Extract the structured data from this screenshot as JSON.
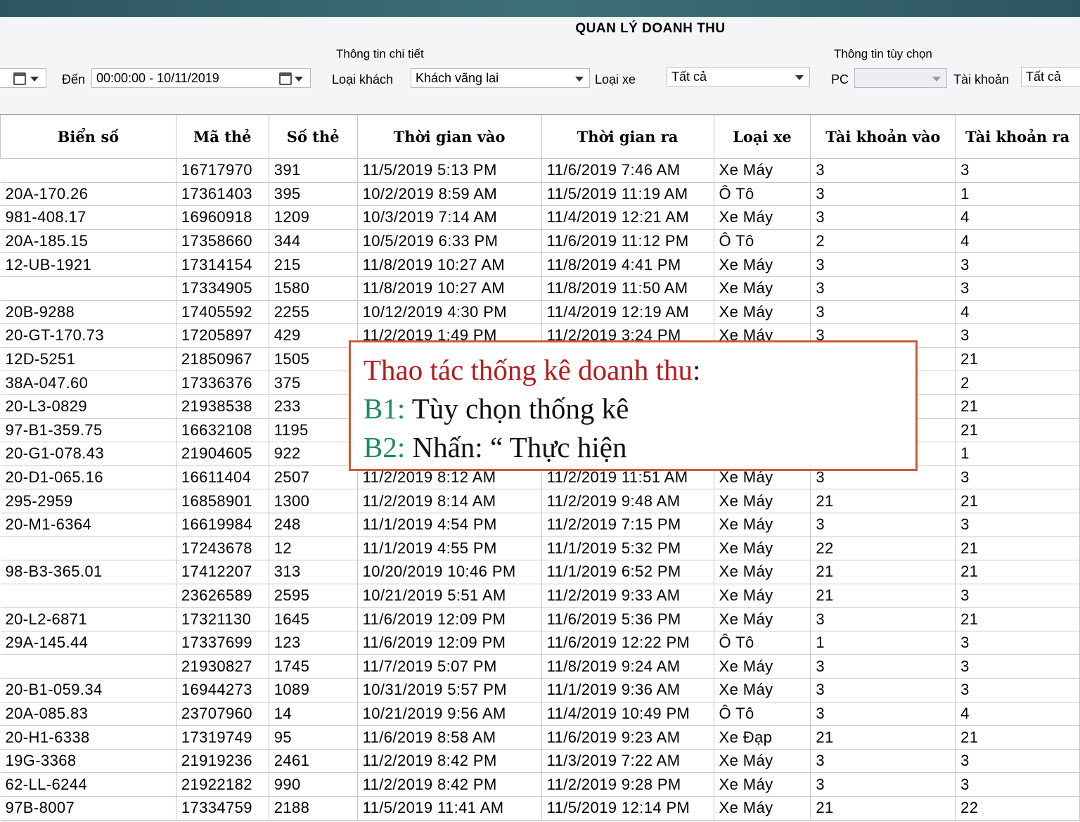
{
  "window": {
    "title": "QUAN LÝ DOANH THU"
  },
  "filters": {
    "to_label": "Đến",
    "to_value": "00:00:00 - 10/11/2019",
    "detail_group": "Thông tin chi tiết",
    "customer_type_label": "Loại khách",
    "customer_type_value": "Khách vãng lai",
    "vehicle_type_label": "Loại xe",
    "vehicle_type_value": "Tất cả",
    "option_group": "Thông tin tùy chọn",
    "pc_label": "PC",
    "pc_value": "",
    "account_label": "Tài khoản",
    "account_value": "Tất cả"
  },
  "table": {
    "columns": [
      "Biển số",
      "Mã thẻ",
      "Số thẻ",
      "Thời gian vào",
      "Thời gian ra",
      "Loại xe",
      "Tài khoản vào",
      "Tài khoản ra"
    ],
    "rows": [
      [
        "",
        "16717970",
        "391",
        "11/5/2019 5:13 PM",
        "11/6/2019 7:46 AM",
        "Xe Máy",
        "3",
        "3"
      ],
      [
        "20A-170.26",
        "17361403",
        "395",
        "10/2/2019 8:59 AM",
        "11/5/2019 11:19 AM",
        "Ô Tô",
        "3",
        "1"
      ],
      [
        "981-408.17",
        "16960918",
        "1209",
        "10/3/2019 7:14 AM",
        "11/4/2019 12:21 AM",
        "Xe Máy",
        "3",
        "4"
      ],
      [
        "20A-185.15",
        "17358660",
        "344",
        "10/5/2019 6:33 PM",
        "11/6/2019 11:12 PM",
        "Ô Tô",
        "2",
        "4"
      ],
      [
        "12-UB-1921",
        "17314154",
        "215",
        "11/8/2019 10:27 AM",
        "11/8/2019 4:41 PM",
        "Xe Máy",
        "3",
        "3"
      ],
      [
        "",
        "17334905",
        "1580",
        "11/8/2019 10:27 AM",
        "11/8/2019 11:50 AM",
        "Xe Máy",
        "3",
        "3"
      ],
      [
        "20B-9288",
        "17405592",
        "2255",
        "10/12/2019 4:30 PM",
        "11/4/2019 12:19 AM",
        "Xe Máy",
        "3",
        "4"
      ],
      [
        "20-GT-170.73",
        "17205897",
        "429",
        "11/2/2019 1:49 PM",
        "11/2/2019 3:24 PM",
        "Xe Máy",
        "3",
        "3"
      ],
      [
        "12D-5251",
        "21850967",
        "1505",
        "",
        "",
        "",
        "",
        "21"
      ],
      [
        "38A-047.60",
        "17336376",
        "375",
        "",
        "",
        "",
        "",
        "2"
      ],
      [
        "20-L3-0829",
        "21938538",
        "233",
        "",
        "",
        "",
        "",
        "21"
      ],
      [
        "97-B1-359.75",
        "16632108",
        "1195",
        "",
        "",
        "",
        "",
        "21"
      ],
      [
        "20-G1-078.43",
        "21904605",
        "922",
        "",
        "",
        "",
        "",
        "1"
      ],
      [
        "20-D1-065.16",
        "16611404",
        "2507",
        "11/2/2019 8:12 AM",
        "11/2/2019 11:51 AM",
        "Xe Máy",
        "3",
        "3"
      ],
      [
        "295-2959",
        "16858901",
        "1300",
        "11/2/2019 8:14 AM",
        "11/2/2019 9:48 AM",
        "Xe Máy",
        "21",
        "21"
      ],
      [
        "20-M1-6364",
        "16619984",
        "248",
        "11/1/2019 4:54 PM",
        "11/2/2019 7:15 PM",
        "Xe Máy",
        "3",
        "3"
      ],
      [
        "",
        "17243678",
        "12",
        "11/1/2019 4:55 PM",
        "11/1/2019 5:32 PM",
        "Xe Máy",
        "22",
        "21"
      ],
      [
        "98-B3-365.01",
        "17412207",
        "313",
        "10/20/2019 10:46 PM",
        "11/1/2019 6:52 PM",
        "Xe Máy",
        "21",
        "21"
      ],
      [
        "",
        "23626589",
        "2595",
        "10/21/2019 5:51 AM",
        "11/2/2019 9:33 AM",
        "Xe Máy",
        "21",
        "3"
      ],
      [
        "20-L2-6871",
        "17321130",
        "1645",
        "11/6/2019 12:09 PM",
        "11/6/2019 5:36 PM",
        "Xe Máy",
        "3",
        "21"
      ],
      [
        "29A-145.44",
        "17337699",
        "123",
        "11/6/2019 12:09 PM",
        "11/6/2019 12:22 PM",
        "Ô Tô",
        "1",
        "3"
      ],
      [
        "",
        "21930827",
        "1745",
        "11/7/2019 5:07 PM",
        "11/8/2019 9:24 AM",
        "Xe Máy",
        "3",
        "3"
      ],
      [
        "20-B1-059.34",
        "16944273",
        "1089",
        "10/31/2019 5:57 PM",
        "11/1/2019 9:36 AM",
        "Xe Máy",
        "3",
        "3"
      ],
      [
        "20A-085.83",
        "23707960",
        "14",
        "10/21/2019 9:56 AM",
        "11/4/2019 10:49 PM",
        "Ô Tô",
        "3",
        "4"
      ],
      [
        "20-H1-6338",
        "17319749",
        "95",
        "11/6/2019 8:58 AM",
        "11/6/2019 9:23 AM",
        "Xe Đạp",
        "21",
        "21"
      ],
      [
        "19G-3368",
        "21919236",
        "2461",
        "11/2/2019 8:42 PM",
        "11/3/2019 7:22 AM",
        "Xe Máy",
        "3",
        "3"
      ],
      [
        "62-LL-6244",
        "21922182",
        "990",
        "11/2/2019 8:42 PM",
        "11/2/2019 9:28 PM",
        "Xe Máy",
        "3",
        "3"
      ],
      [
        "97B-8007",
        "17334759",
        "2188",
        "11/5/2019 11:41 AM",
        "11/5/2019 12:14 PM",
        "Xe Máy",
        "21",
        "22"
      ]
    ]
  },
  "callout": {
    "title": "Thao tác thống kê doanh thu",
    "title_colon": ":",
    "step1_label": "B1:",
    "step1_text": "Tùy chọn thống kê",
    "step2_label": "B2:",
    "step2_text": "Nhấn: “ Thực hiện"
  }
}
